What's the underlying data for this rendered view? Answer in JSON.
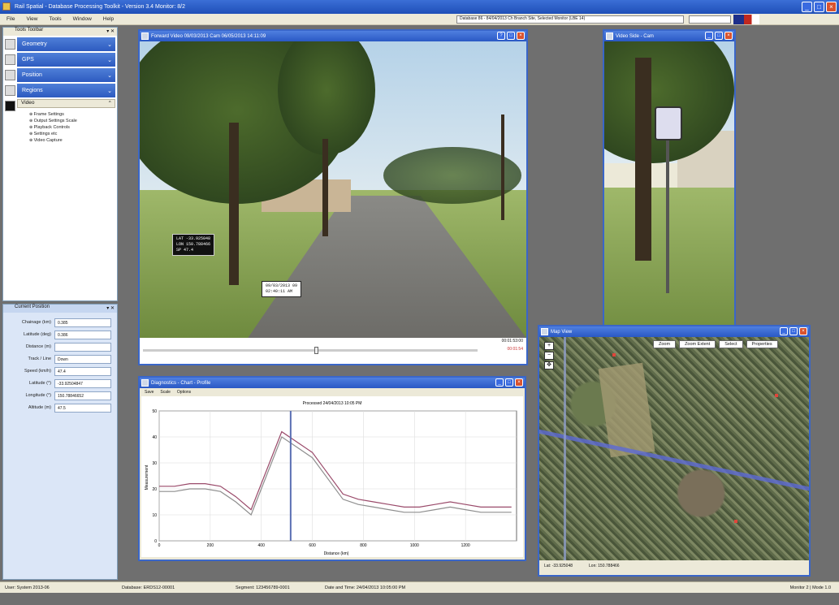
{
  "app": {
    "title": "Rail Spatial - Database Processing Toolkit - Version 3.4 Monitor: 8/2",
    "menu": [
      "File",
      "View",
      "Tools",
      "Window",
      "Help"
    ],
    "address": "Database 86 - 84/04/2013 Ch Branch Site, Selected Monitor (LBE 14)"
  },
  "tools_panel": {
    "title": "Tools Toolbar",
    "buttons": [
      "Geometry",
      "GPS",
      "Position",
      "Regions"
    ],
    "subsection": "Video",
    "tree": [
      "Frame Settings",
      "Output Settings Scale",
      "Playback Controls",
      "Settings etc",
      "Video Capture"
    ]
  },
  "location_panel": {
    "title": "Current Position",
    "fields": [
      {
        "label": "Chainage (km)",
        "value": "0.385"
      },
      {
        "label": "Latitude (deg)",
        "value": "0.386"
      },
      {
        "label": "Distance (m)",
        "value": ""
      },
      {
        "label": "Track / Line",
        "value": "Down"
      },
      {
        "label": "Speed (km/h)",
        "value": "47.4"
      },
      {
        "label": "Latitude (°)",
        "value": "-33.92504847"
      },
      {
        "label": "Longitude (°)",
        "value": "150.78846652"
      },
      {
        "label": "Altitude (m)",
        "value": "47.5"
      }
    ]
  },
  "video_main": {
    "title": "Forward Video 09/03/2013 Cam 06/05/2013 14:11:09",
    "overlay": [
      "LAT   -33.925048",
      "LON  150.788466",
      "SP          47.4"
    ],
    "overlay2": [
      "09/03/2013 09",
      "02:40:11 AM"
    ],
    "time_current": "00:01:53:00",
    "time_total": "00:01:54"
  },
  "video_side": {
    "title": "Video Side - Cam"
  },
  "diagnostics": {
    "title": "Diagnostics - Chart - Profile",
    "menu": [
      "Save",
      "Scale",
      "Options"
    ]
  },
  "map_window": {
    "title": "Map View",
    "tools": [
      "Zoom",
      "Zoom Extent",
      "Select",
      "Properties"
    ],
    "status": [
      "Lat: -33.925048",
      "Lon: 150.788466"
    ]
  },
  "status": {
    "left": "User: System 2013-06",
    "mid1": "Database: ERDS12-00001",
    "mid2": "Segment: 123456789-0001",
    "mid3": "Date and Time: 24/04/2013 10:05:00 PM",
    "right": "Monitor 2 | Mode 1.0"
  },
  "chart_data": {
    "type": "line",
    "title": "Processed 24/04/2013 10:05 PM",
    "xlabel": "Distance (km)",
    "ylabel": "Measurement",
    "xlim": [
      0,
      1400
    ],
    "ylim": [
      0,
      50
    ],
    "x": [
      0,
      60,
      120,
      180,
      240,
      300,
      360,
      420,
      480,
      540,
      600,
      660,
      720,
      780,
      840,
      900,
      960,
      1020,
      1080,
      1140,
      1200,
      1260,
      1320,
      1380
    ],
    "series": [
      {
        "name": "",
        "color": "#9a4a6a",
        "values": [
          21,
          21,
          22,
          22,
          21,
          17,
          12,
          27,
          42,
          38,
          34,
          26,
          18,
          16,
          15,
          14,
          13,
          13,
          14,
          15,
          14,
          13,
          13,
          13
        ]
      },
      {
        "name": "",
        "color": "#8e8e8e",
        "values": [
          19,
          19,
          20,
          20,
          19,
          15,
          10,
          25,
          40,
          36,
          32,
          24,
          16,
          14,
          13,
          12,
          11,
          11,
          12,
          13,
          12,
          11,
          11,
          11
        ]
      }
    ],
    "xticks": [
      0,
      200,
      400,
      600,
      800,
      1000,
      1200
    ],
    "yticks": [
      0,
      10,
      20,
      30,
      40,
      50
    ],
    "marker_x": 515,
    "grid": true,
    "legend": "top-left"
  }
}
